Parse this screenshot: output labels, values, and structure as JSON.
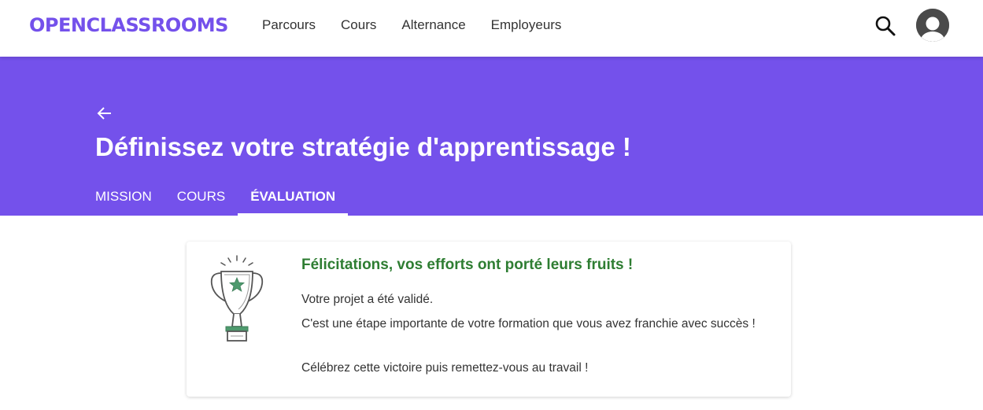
{
  "header": {
    "logo_text": "OPENCLASSROOMS",
    "nav": [
      "Parcours",
      "Cours",
      "Alternance",
      "Employeurs"
    ]
  },
  "hero": {
    "title": "Définissez votre stratégie d'apprentissage !",
    "tabs": [
      {
        "label": "MISSION",
        "active": false
      },
      {
        "label": "COURS",
        "active": false
      },
      {
        "label": "ÉVALUATION",
        "active": true
      }
    ]
  },
  "card": {
    "title": "Félicitations, vos efforts ont porté leurs fruits !",
    "paragraphs": [
      "Votre projet a été validé.",
      "C'est une étape importante de votre formation que vous avez franchie avec succès !",
      "Célébrez cette victoire puis remettez-vous au travail !"
    ]
  },
  "icons": {
    "search": "search-icon",
    "avatar": "user-avatar-icon",
    "back": "arrow-left-icon",
    "trophy": "trophy-icon"
  },
  "colors": {
    "brand": "#7451eb",
    "success": "#2e7d32",
    "trophy_accent": "#4e9a6e"
  }
}
